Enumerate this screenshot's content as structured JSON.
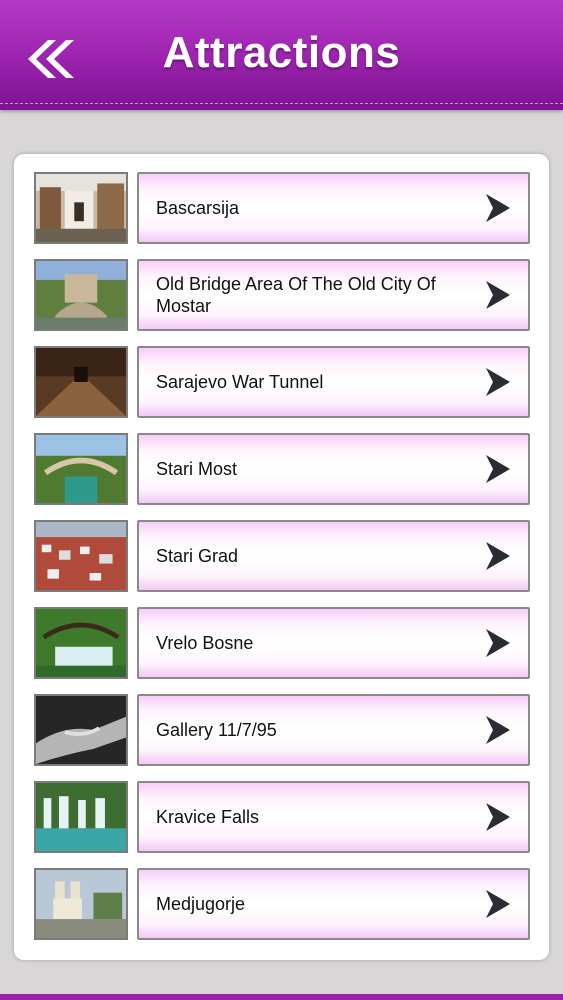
{
  "header": {
    "title": "Attractions",
    "back_icon": "double-chevron-left-icon"
  },
  "attractions": [
    {
      "name": "Bascarsija"
    },
    {
      "name": "Old Bridge Area Of The Old City Of Mostar"
    },
    {
      "name": "Sarajevo War Tunnel"
    },
    {
      "name": "Stari Most"
    },
    {
      "name": "Stari Grad"
    },
    {
      "name": "Vrelo Bosne"
    },
    {
      "name": "Gallery 11/7/95"
    },
    {
      "name": "Kravice Falls"
    },
    {
      "name": "Medjugorje"
    }
  ],
  "colors": {
    "header": "#9a22ad",
    "item_highlight": "#f3c7f6",
    "background": "#d8d6d7"
  }
}
